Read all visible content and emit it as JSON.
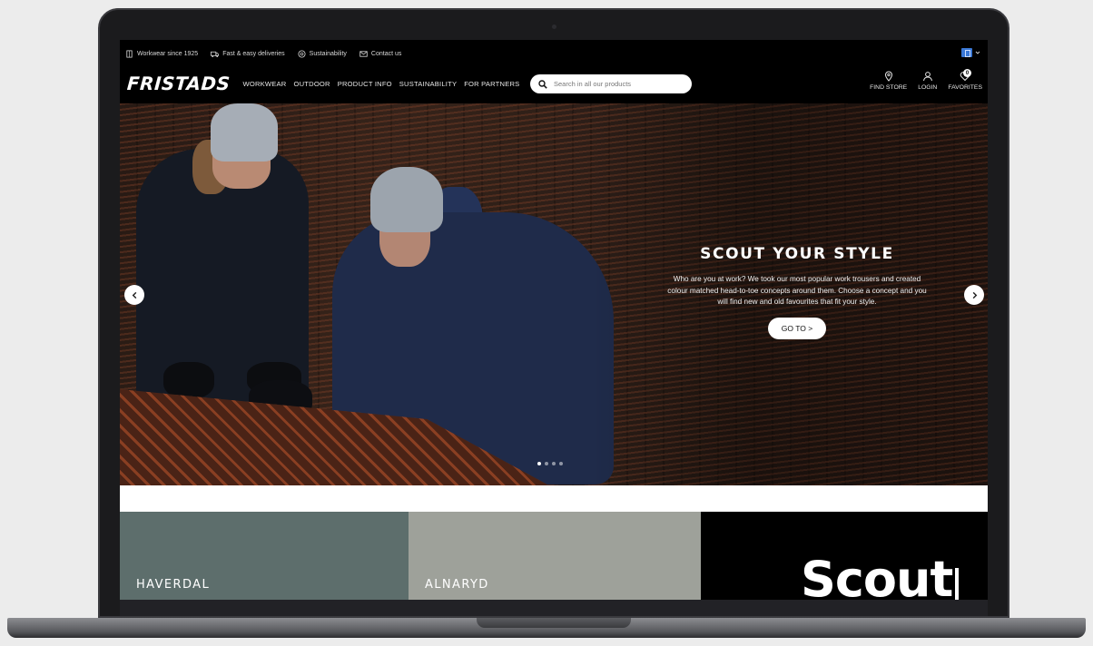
{
  "utility_bar": {
    "items": [
      {
        "icon": "shirt-icon",
        "label": "Workwear since 1925"
      },
      {
        "icon": "truck-icon",
        "label": "Fast & easy deliveries"
      },
      {
        "icon": "leaf-icon",
        "label": "Sustainability"
      },
      {
        "icon": "mail-icon",
        "label": "Contact us"
      }
    ],
    "language_flag": "flag-icon"
  },
  "header": {
    "logo": "FRISTADS",
    "nav": [
      "WORKWEAR",
      "OUTDOOR",
      "PRODUCT INFO",
      "SUSTAINABILITY",
      "FOR PARTNERS"
    ],
    "search_placeholder": "Search in all our products",
    "actions": {
      "find_store": "FIND STORE",
      "login": "LOGIN",
      "favorites": "FAVORITES",
      "favorites_count": "0"
    }
  },
  "hero": {
    "title": "SCOUT YOUR STYLE",
    "text": "Who are you at work? We took our most popular work trousers and created colour matched head-to-toe concepts around them. Choose a concept and you will find new and old favourites that fit your style.",
    "cta": "GO TO >",
    "slide_count": 4,
    "active_slide": 1
  },
  "tiles": {
    "haverdal": "HAVERDAL",
    "alnaryd": "ALNARYD",
    "scout": "Scout"
  },
  "colors": {
    "page_bg": "#000000",
    "tile_haverdal": "#5d6e6c",
    "tile_alnaryd": "#9ea19a",
    "tile_scout": "#000000"
  }
}
